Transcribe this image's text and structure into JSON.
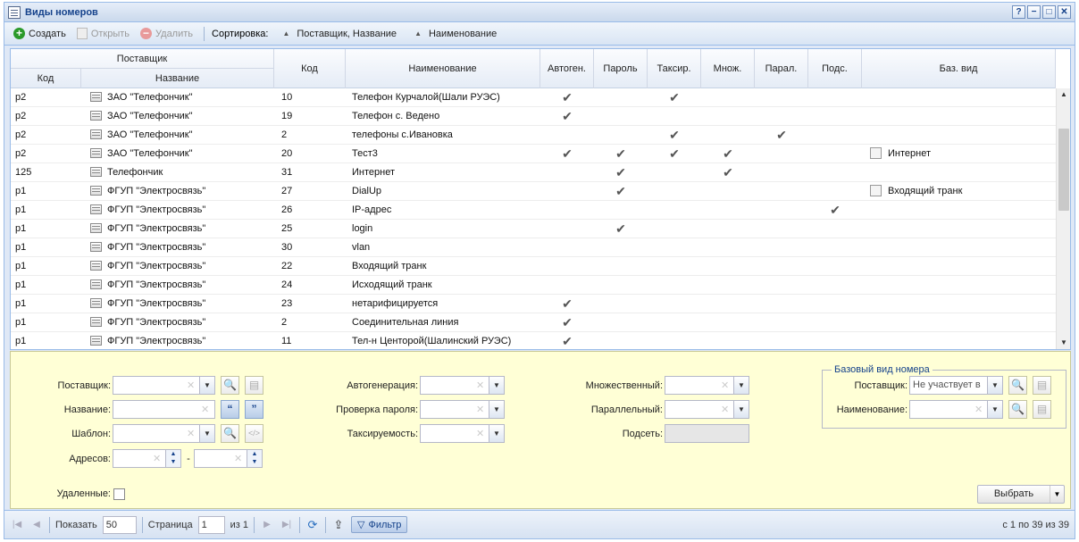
{
  "window": {
    "title": "Виды номеров",
    "tools": [
      "?",
      "−",
      "□",
      "✕"
    ]
  },
  "toolbar": {
    "create": "Создать",
    "open": "Открыть",
    "delete": "Удалить",
    "sort_label": "Сортировка:",
    "sort_1": "Поставщик, Название",
    "sort_2": "Наименование"
  },
  "grid": {
    "headers": {
      "provider_group": "Поставщик",
      "code": "Код",
      "name": "Название",
      "code2": "Код",
      "title": "Наименование",
      "autogen": "Автоген.",
      "password": "Пароль",
      "tariff": "Таксир.",
      "multi": "Множ.",
      "parallel": "Парал.",
      "subnet": "Подс.",
      "base": "Баз. вид"
    },
    "rows": [
      {
        "pcode": "p2",
        "pname": "ЗАО \"Телефончик\"",
        "code": "10",
        "title": "Телефон Курчалой(Шали РУЭС)",
        "autogen": true,
        "password": false,
        "tariff": true,
        "multi": false,
        "parallel": false,
        "subnet": false,
        "base": ""
      },
      {
        "pcode": "p2",
        "pname": "ЗАО \"Телефончик\"",
        "code": "19",
        "title": "Телефон с. Ведено",
        "autogen": true,
        "password": false,
        "tariff": false,
        "multi": false,
        "parallel": false,
        "subnet": false,
        "base": ""
      },
      {
        "pcode": "p2",
        "pname": "ЗАО \"Телефончик\"",
        "code": "2",
        "title": "телефоны с.Ивановка",
        "autogen": false,
        "password": false,
        "tariff": true,
        "multi": false,
        "parallel": true,
        "subnet": false,
        "base": ""
      },
      {
        "pcode": "p2",
        "pname": "ЗАО \"Телефончик\"",
        "code": "20",
        "title": "Тест3",
        "autogen": true,
        "password": true,
        "tariff": true,
        "multi": true,
        "parallel": false,
        "subnet": false,
        "base": "Интернет"
      },
      {
        "pcode": "125",
        "pname": "Телефончик",
        "code": "31",
        "title": "Интернет",
        "autogen": false,
        "password": true,
        "tariff": false,
        "multi": true,
        "parallel": false,
        "subnet": false,
        "base": ""
      },
      {
        "pcode": "p1",
        "pname": "ФГУП \"Электросвязь\"",
        "code": "27",
        "title": "DialUp",
        "autogen": false,
        "password": true,
        "tariff": false,
        "multi": false,
        "parallel": false,
        "subnet": false,
        "base": "Входящий транк"
      },
      {
        "pcode": "p1",
        "pname": "ФГУП \"Электросвязь\"",
        "code": "26",
        "title": "IP-адрес",
        "autogen": false,
        "password": false,
        "tariff": false,
        "multi": false,
        "parallel": false,
        "subnet": true,
        "base": ""
      },
      {
        "pcode": "p1",
        "pname": "ФГУП \"Электросвязь\"",
        "code": "25",
        "title": "login",
        "autogen": false,
        "password": true,
        "tariff": false,
        "multi": false,
        "parallel": false,
        "subnet": false,
        "base": ""
      },
      {
        "pcode": "p1",
        "pname": "ФГУП \"Электросвязь\"",
        "code": "30",
        "title": "vlan",
        "autogen": false,
        "password": false,
        "tariff": false,
        "multi": false,
        "parallel": false,
        "subnet": false,
        "base": ""
      },
      {
        "pcode": "p1",
        "pname": "ФГУП \"Электросвязь\"",
        "code": "22",
        "title": "Входящий транк",
        "autogen": false,
        "password": false,
        "tariff": false,
        "multi": false,
        "parallel": false,
        "subnet": false,
        "base": ""
      },
      {
        "pcode": "p1",
        "pname": "ФГУП \"Электросвязь\"",
        "code": "24",
        "title": "Исходящий транк",
        "autogen": false,
        "password": false,
        "tariff": false,
        "multi": false,
        "parallel": false,
        "subnet": false,
        "base": ""
      },
      {
        "pcode": "p1",
        "pname": "ФГУП \"Электросвязь\"",
        "code": "23",
        "title": "нетарифицируется",
        "autogen": true,
        "password": false,
        "tariff": false,
        "multi": false,
        "parallel": false,
        "subnet": false,
        "base": ""
      },
      {
        "pcode": "p1",
        "pname": "ФГУП \"Электросвязь\"",
        "code": "2",
        "title": "Соединительная линия",
        "autogen": true,
        "password": false,
        "tariff": false,
        "multi": false,
        "parallel": false,
        "subnet": false,
        "base": ""
      },
      {
        "pcode": "p1",
        "pname": "ФГУП \"Электросвязь\"",
        "code": "11",
        "title": "Тел-н Центорой(Шалинский РУЭС)",
        "autogen": true,
        "password": false,
        "tariff": false,
        "multi": false,
        "parallel": false,
        "subnet": false,
        "base": ""
      }
    ]
  },
  "filter": {
    "provider_label": "Поставщик:",
    "name_label": "Название:",
    "template_label": "Шаблон:",
    "addresses_label": "Адресов:",
    "range_dash": "-",
    "deleted_label": "Удаленные:",
    "autogen_label": "Автогенерация:",
    "password_label": "Проверка пароля:",
    "tariff_label": "Таксируемость:",
    "multi_label": "Множественный:",
    "parallel_label": "Параллельный:",
    "subnet_label": "Подсеть:",
    "base_legend": "Базовый вид номера",
    "base_provider_label": "Поставщик:",
    "base_provider_value": "Не участвует в",
    "base_name_label": "Наименование:",
    "select_button": "Выбрать"
  },
  "pager": {
    "show_label": "Показать",
    "page_size": "50",
    "page_label": "Страница",
    "page": "1",
    "of_label": "из 1",
    "filter_button": "Фильтр",
    "info": "с 1 по 39 из 39"
  },
  "check_glyph": "✔"
}
